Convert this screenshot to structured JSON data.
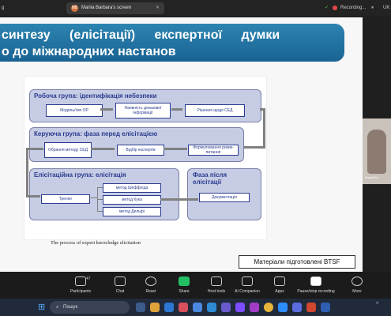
{
  "top_bar": {
    "left_fragment": "g",
    "tab_title": "Mariia Barbara's screen",
    "tab_avatar": "MB",
    "recording": "Recording...",
    "region": "UK"
  },
  "slide": {
    "title_line1": "синтезу (елісітації) експертної думки",
    "title_line2": "о до міжнародних настанов",
    "diagram": {
      "working_group": {
        "title": "Робоча група: ідентифікація небезпеки",
        "boxes": [
          "Модель/тип ОР",
          "Наявність доказової інформації",
          "Рішення щодо СЕД"
        ]
      },
      "steering_group": {
        "title": "Керуюча група: фаза перед елісітацією",
        "boxes": [
          "Обрання методу СЕД",
          "Відбір експертів",
          "Формулювання ризик-питання"
        ]
      },
      "elicitation_group": {
        "title": "Елісітаційна група: елісітація",
        "training": "Тренінг",
        "methods": [
          "метод Шеффілда",
          "метод Кука",
          "метод Дельфі"
        ]
      },
      "post_phase": {
        "title": "Фаза після елісітації",
        "box": "Документація"
      },
      "caption": "The process of expert knowledge elicitation"
    },
    "materials_note": "Матеріали підготовлені BTSF"
  },
  "video": {
    "name": "Mariia Ba"
  },
  "meeting_toolbar": [
    {
      "label": "Participants",
      "count": "47",
      "icon": "participants-icon"
    },
    {
      "label": "Chat",
      "icon": "chat-icon"
    },
    {
      "label": "React",
      "icon": "react-icon"
    },
    {
      "label": "Share",
      "icon": "share-icon"
    },
    {
      "label": "Host tools",
      "icon": "shield-icon"
    },
    {
      "label": "AI Companion",
      "icon": "ai-icon"
    },
    {
      "label": "Apps",
      "icon": "apps-icon"
    },
    {
      "label": "Pause/stop recording",
      "icon": "pause-icon"
    },
    {
      "label": "More",
      "icon": "more-icon"
    }
  ],
  "taskbar": {
    "search_placeholder": "Пошук"
  },
  "colors": {
    "banner": "#1f6fa0",
    "panel": "#c6cce4",
    "panel_title": "#2a3b8f",
    "share_green": "#23c063"
  }
}
